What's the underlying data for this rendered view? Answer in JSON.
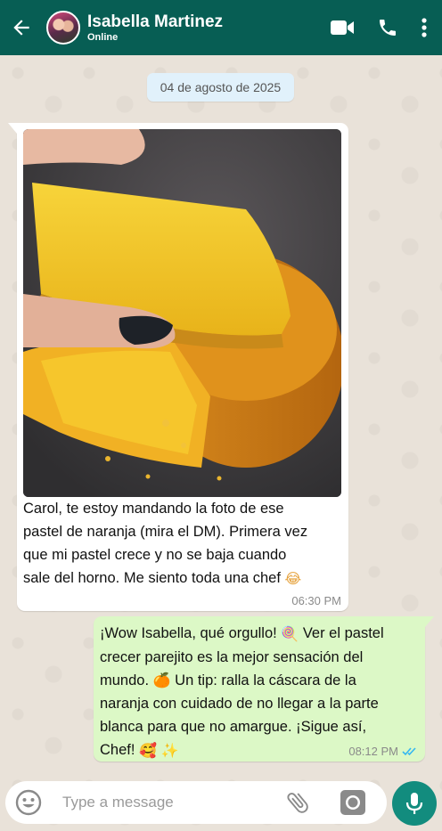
{
  "header": {
    "contact_name": "Isabella Martinez",
    "status": "Online",
    "icons": [
      "back-arrow-icon",
      "video-call-icon",
      "phone-icon",
      "more-vert-icon"
    ]
  },
  "date_separator": "04 de agosto de 2025",
  "messages": [
    {
      "direction": "incoming",
      "has_image": true,
      "image_description_icon": "orange-cake-photo",
      "text_lines": [
        "Carol, te estoy mandando la foto de ese",
        "pastel de naranja (mira el DM). Primera vez",
        "que mi pastel crece y no se baja cuando",
        "sale del horno. Me siento toda una chef"
      ],
      "emoji_end": "😂",
      "time": "06:30 PM"
    },
    {
      "direction": "outgoing",
      "line1": "¡Wow Isabella, qué orgullo!",
      "line1_emoji": "🍭",
      "line1_rest": "Ver el pastel",
      "line2": "crecer parejito es la mejor sensación del",
      "line3": "mundo.",
      "line3_emoji": "🍊",
      "line3_rest": "Un tip: ralla la cáscara de la",
      "line4": "naranja con cuidado de no llegar a la parte",
      "line5": "blanca para que no amargue. ¡Sigue así,",
      "line6": "Chef!",
      "line6_emoji1": "🥰",
      "line6_emoji2": "✨",
      "time": "08:12 PM",
      "status_icon": "double-check-read-icon"
    }
  ],
  "composer": {
    "placeholder": "Type a message",
    "icons": [
      "emoji-icon",
      "attach-icon",
      "camera-icon",
      "mic-icon"
    ]
  },
  "colors": {
    "header": "#075e54",
    "outgoing_bubble": "#dcf8c6",
    "incoming_bubble": "#ffffff",
    "mic_button": "#128c7e",
    "read_ticks": "#34b7f1"
  }
}
